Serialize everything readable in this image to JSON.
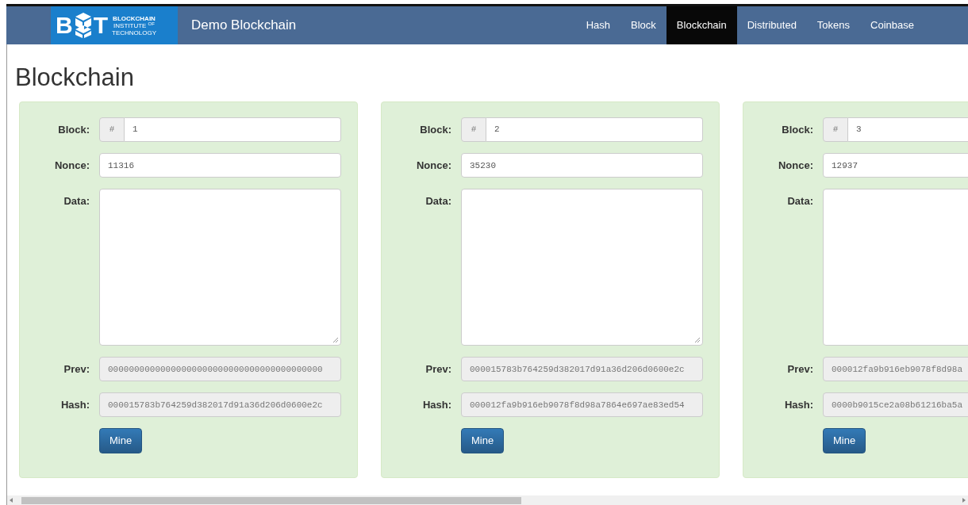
{
  "navbar": {
    "logo": {
      "letter_left": "B",
      "letter_right": "T",
      "lines": [
        "BLOCKCHAIN",
        "INSTITUTE $^{OF}$",
        "TECHNOLOGY"
      ]
    },
    "brand": "Demo Blockchain",
    "items": [
      {
        "label": "Hash",
        "selected": false
      },
      {
        "label": "Block",
        "selected": false
      },
      {
        "label": "Blockchain",
        "selected": true
      },
      {
        "label": "Distributed",
        "selected": false
      },
      {
        "label": "Tokens",
        "selected": false
      },
      {
        "label": "Coinbase",
        "selected": false
      }
    ]
  },
  "page_title": "Blockchain",
  "blocks": [
    {
      "block_label": "Block:",
      "addon": "#",
      "block": "1",
      "nonce_label": "Nonce:",
      "nonce": "11316",
      "data_label": "Data:",
      "prev_label": "Prev:",
      "prev": "00000000000000000000000000000000000000000",
      "hash_label": "Hash:",
      "hash": "000015783b764259d382017d91a36d206d0600e2c",
      "button": "Mine"
    },
    {
      "block_label": "Block:",
      "addon": "#",
      "block": "2",
      "nonce_label": "Nonce:",
      "nonce": "35230",
      "data_label": "Data:",
      "prev_label": "Prev:",
      "prev": "000015783b764259d382017d91a36d206d0600e2c",
      "hash_label": "Hash:",
      "hash": "000012fa9b916eb9078f8d98a7864e697ae83ed54",
      "button": "Mine"
    },
    {
      "block_label": "Block:",
      "addon": "#",
      "block": "3",
      "nonce_label": "Nonce:",
      "nonce": "12937",
      "data_label": "Data:",
      "prev_label": "Prev:",
      "prev": "000012fa9b916eb9078f8d98a",
      "hash_label": "Hash:",
      "hash": "0000b9015ce2a08b61216ba5a",
      "button": "Mine"
    }
  ]
}
